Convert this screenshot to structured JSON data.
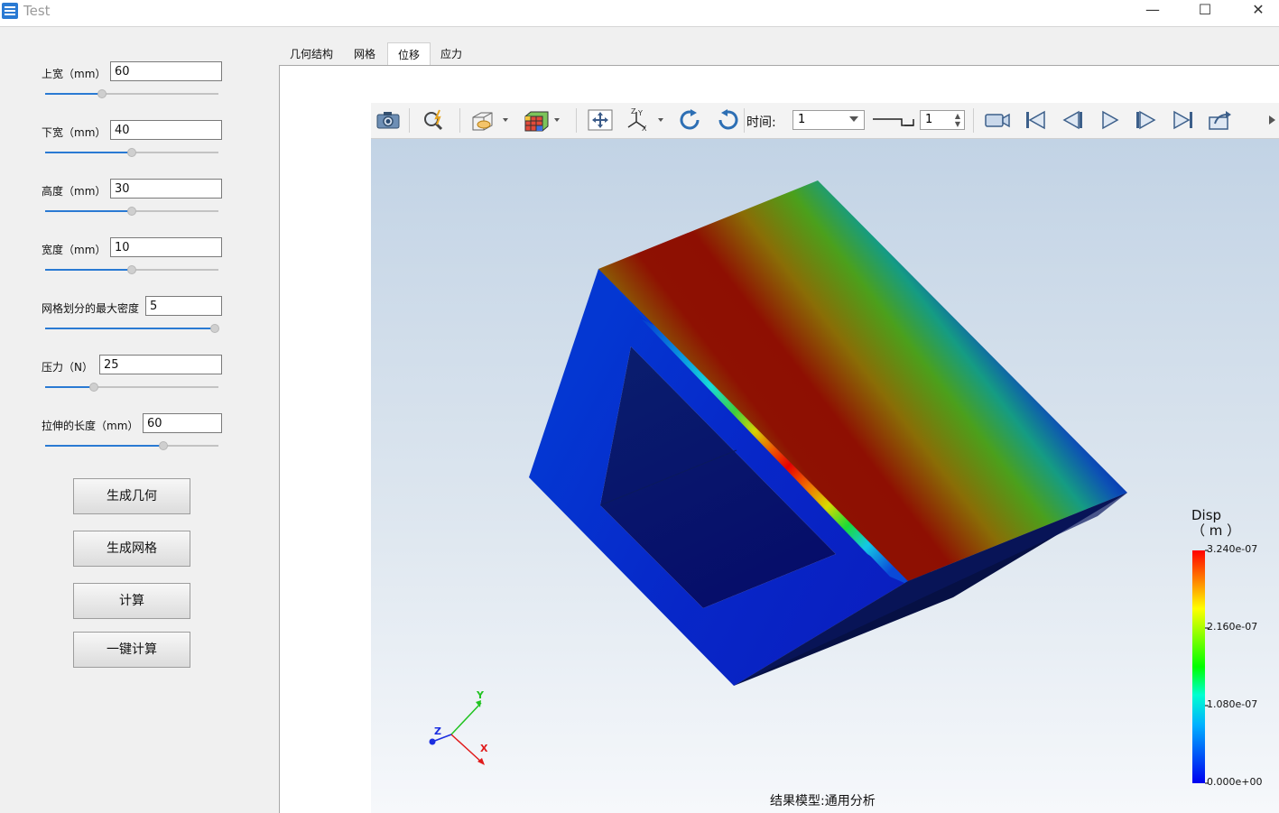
{
  "window": {
    "title": "Test",
    "controls": {
      "minimize": "—",
      "maximize": "☐",
      "close": "✕"
    }
  },
  "sidebar": {
    "params": [
      {
        "label": "上宽（mm）",
        "value": "60",
        "slider": 0.33
      },
      {
        "label": "下宽（mm）",
        "value": "40",
        "slider": 0.5
      },
      {
        "label": "高度（mm）",
        "value": "30",
        "slider": 0.5
      },
      {
        "label": "宽度（mm）",
        "value": "10",
        "slider": 0.5
      },
      {
        "label": "网格划分的最大密度",
        "value": "5",
        "slider": 1.0
      },
      {
        "label": "压力（N）",
        "value": "25",
        "slider": 0.28
      },
      {
        "label": "拉伸的长度（mm）",
        "value": "60",
        "slider": 0.68
      }
    ],
    "buttons": {
      "gen_geometry": "生成几何",
      "gen_mesh": "生成网格",
      "compute": "计算",
      "one_click": "一键计算"
    }
  },
  "tabs": [
    "几何结构",
    "网格",
    "位移",
    "应力"
  ],
  "active_tab": "位移",
  "toolbar": {
    "time_label": "时间:",
    "time_value": "1",
    "step_value": "1",
    "icons": [
      "camera-icon",
      "zoom-icon",
      "display-mode-icon",
      "color-cube-icon",
      "pan-icon",
      "axis-orient-icon",
      "rotate-cw-icon",
      "rotate-ccw-icon",
      "record-video-icon",
      "first-frame-icon",
      "prev-frame-icon",
      "play-icon",
      "next-frame-icon",
      "last-frame-icon",
      "export-icon"
    ]
  },
  "viewport": {
    "model_label": "结果模型:通用分析",
    "axes": {
      "x": "X",
      "y": "Y",
      "z": "Z"
    },
    "legend": {
      "title": "Disp",
      "unit": "（ m ）",
      "ticks": [
        "3.240e-07",
        "2.160e-07",
        "1.080e-07",
        "0.000e+00"
      ],
      "colors": [
        "#ff0000",
        "#ffff00",
        "#00ff00",
        "#00ffff",
        "#0000ff"
      ]
    }
  },
  "colors": {
    "accent": "#2a7ad3"
  }
}
